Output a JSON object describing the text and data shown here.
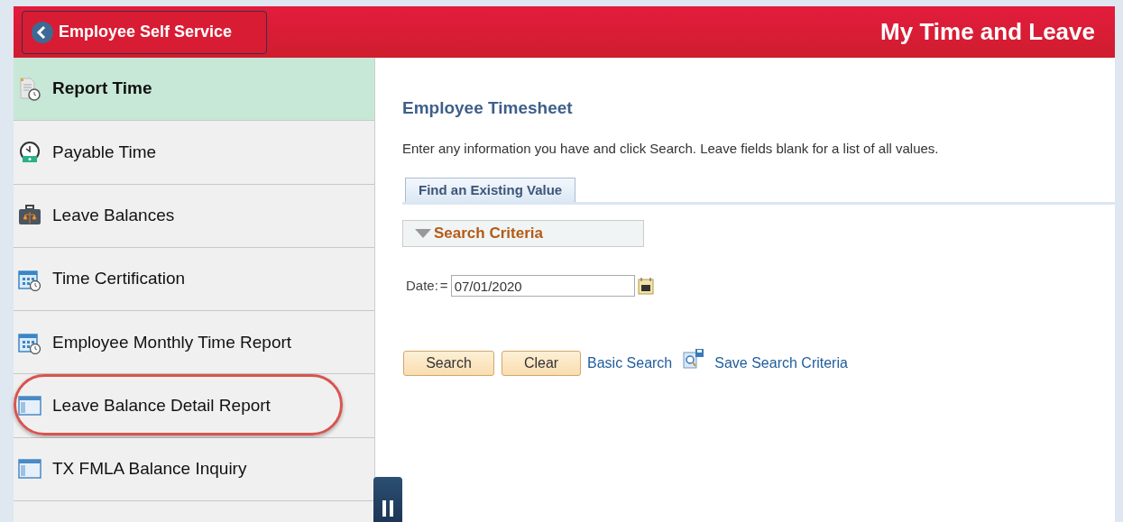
{
  "header": {
    "back_button": "Employee Self Service",
    "title": "My Time and Leave"
  },
  "sidebar": {
    "items": [
      {
        "label": "Report Time",
        "kind": "document",
        "selected": true,
        "circled": false
      },
      {
        "label": "Payable Time",
        "kind": "payclock",
        "selected": false,
        "circled": false
      },
      {
        "label": "Leave Balances",
        "kind": "briefcase",
        "selected": false,
        "circled": false
      },
      {
        "label": "Time Certification",
        "kind": "calendar",
        "selected": false,
        "circled": false
      },
      {
        "label": "Employee Monthly Time Report",
        "kind": "calendar",
        "selected": false,
        "circled": false
      },
      {
        "label": "Leave Balance Detail Report",
        "kind": "report",
        "selected": false,
        "circled": true
      },
      {
        "label": "TX FMLA Balance Inquiry",
        "kind": "report",
        "selected": false,
        "circled": false
      }
    ]
  },
  "main": {
    "title": "Employee Timesheet",
    "instructions": "Enter any information you have and click Search. Leave fields blank for a list of all values.",
    "tabs": [
      {
        "label": "Find an Existing Value",
        "selected": true
      }
    ],
    "section": {
      "title": "Search Criteria",
      "expanded": true
    },
    "date_field": {
      "label": "Date:",
      "operator": "=",
      "value": "07/01/2020"
    },
    "buttons": [
      "Search",
      "Clear"
    ],
    "links": [
      "Basic Search",
      "Save Search Criteria"
    ]
  }
}
